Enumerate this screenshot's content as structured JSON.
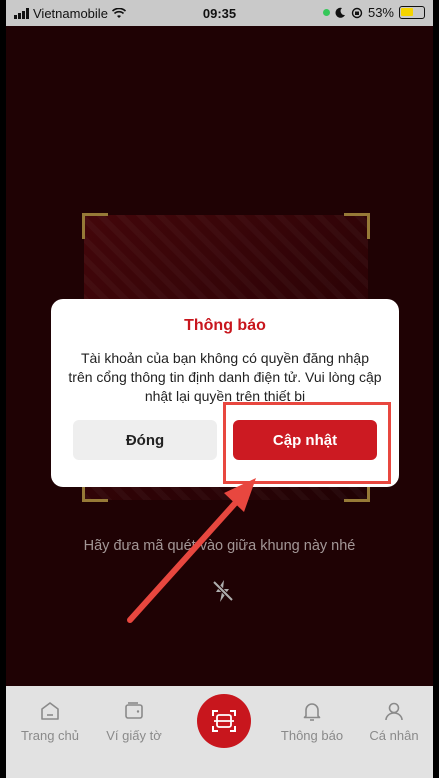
{
  "status_bar": {
    "carrier": "Vietnamobile",
    "time": "09:35",
    "battery": "53%"
  },
  "dialog": {
    "title": "Thông báo",
    "message": "Tài khoản của bạn không có quyền đăng nhập trên cổng thông tin định danh điện tử. Vui lòng cập nhật lại quyền trên thiết bị",
    "close_label": "Đóng",
    "update_label": "Cập nhật"
  },
  "scanner": {
    "hint": "Hãy đưa mã quét vào giữa khung này nhé"
  },
  "bottom_nav": {
    "items": [
      {
        "label": "Trang chủ",
        "icon": "home-icon"
      },
      {
        "label": "Ví giấy tờ",
        "icon": "wallet-icon"
      },
      {
        "label": "",
        "icon": "scan-icon"
      },
      {
        "label": "Thông báo",
        "icon": "bell-icon"
      },
      {
        "label": "Cá nhân",
        "icon": "user-icon"
      }
    ]
  },
  "colors": {
    "accent": "#c8161d",
    "background": "#2a0306",
    "annotation": "#e8473f"
  }
}
